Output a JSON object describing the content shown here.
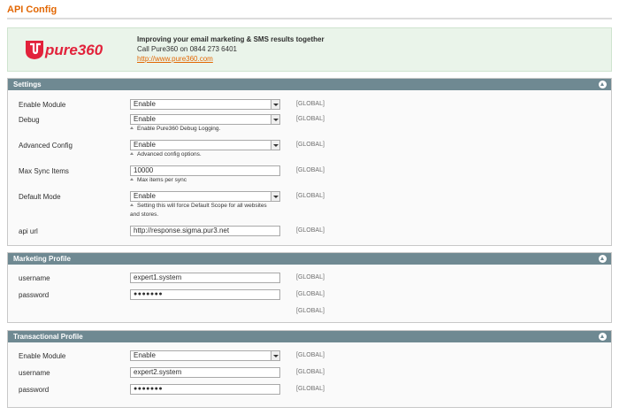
{
  "page": {
    "title": "API Config"
  },
  "banner": {
    "headline": "Improving your email marketing & SMS results together",
    "phone": "Call Pure360 on 0844 273 6401",
    "link": "http://www.pure360.com",
    "logo_text": "pure360",
    "brand_color": "#e2223b"
  },
  "settings": {
    "header": "Settings",
    "enable_module": {
      "label": "Enable Module",
      "value": "Enable",
      "scope": "[GLOBAL]"
    },
    "debug": {
      "label": "Debug",
      "value": "Enable",
      "scope": "[GLOBAL]",
      "note": "Enable Pure360 Debug Logging."
    },
    "advanced_config": {
      "label": "Advanced Config",
      "value": "Enable",
      "scope": "[GLOBAL]",
      "note": "Advanced config options."
    },
    "max_sync_items": {
      "label": "Max Sync Items",
      "value": "10000",
      "scope": "[GLOBAL]",
      "note": "Max items per sync"
    },
    "default_mode": {
      "label": "Default Mode",
      "value": "Enable",
      "scope": "[GLOBAL]",
      "note_line1": "Setting this will force Default Scope for all websites",
      "note_line2": "and stores."
    },
    "api_url": {
      "label": "api url",
      "value": "http://response.sigma.pur3.net",
      "scope": "[GLOBAL]"
    }
  },
  "marketing": {
    "header": "Marketing Profile",
    "username": {
      "label": "username",
      "value": "expert1.system",
      "scope": "[GLOBAL]"
    },
    "password": {
      "label": "password",
      "value": "●●●●●●●",
      "scope": "[GLOBAL]"
    },
    "extra_scope": "[GLOBAL]"
  },
  "transactional": {
    "header": "Transactional Profile",
    "enable_module": {
      "label": "Enable Module",
      "value": "Enable",
      "scope": "[GLOBAL]"
    },
    "username": {
      "label": "username",
      "value": "expert2.system",
      "scope": "[GLOBAL]"
    },
    "password": {
      "label": "password",
      "value": "●●●●●●●",
      "scope": "[GLOBAL]"
    }
  },
  "icons": {
    "collapse": "collapse-up-icon",
    "dropdown": "chevron-down-icon",
    "note": "note-arrow-icon"
  },
  "colors": {
    "accent": "#e26703",
    "section_header": "#6f8992",
    "banner_bg": "#eaf4ea"
  }
}
